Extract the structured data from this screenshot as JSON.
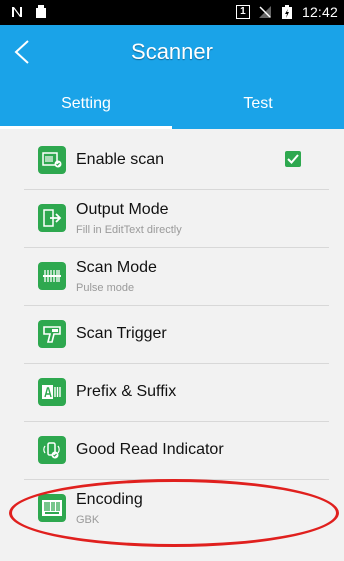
{
  "status_bar": {
    "time": "12:42",
    "sim_slot": "1"
  },
  "app_bar": {
    "title": "Scanner"
  },
  "tabs": [
    {
      "label": "Setting",
      "active": true
    },
    {
      "label": "Test",
      "active": false
    }
  ],
  "settings": [
    {
      "label": "Enable scan",
      "sublabel": "",
      "icon": "barcode-scan-icon",
      "checked": true
    },
    {
      "label": "Output Mode",
      "sublabel": "Fill in EditText directly",
      "icon": "output-arrow-icon"
    },
    {
      "label": "Scan Mode",
      "sublabel": "Pulse mode",
      "icon": "scan-mode-icon"
    },
    {
      "label": "Scan Trigger",
      "sublabel": "",
      "icon": "scanner-trigger-icon"
    },
    {
      "label": "Prefix & Suffix",
      "sublabel": "",
      "icon": "prefix-suffix-icon"
    },
    {
      "label": "Good Read Indicator",
      "sublabel": "",
      "icon": "good-read-indicator-icon"
    },
    {
      "label": "Encoding",
      "sublabel": "GBK",
      "icon": "barcode-encoding-icon"
    }
  ],
  "colors": {
    "accent": "#1aa3e8",
    "icon_green": "#2ea84f",
    "annotation_red": "#e0201e"
  }
}
